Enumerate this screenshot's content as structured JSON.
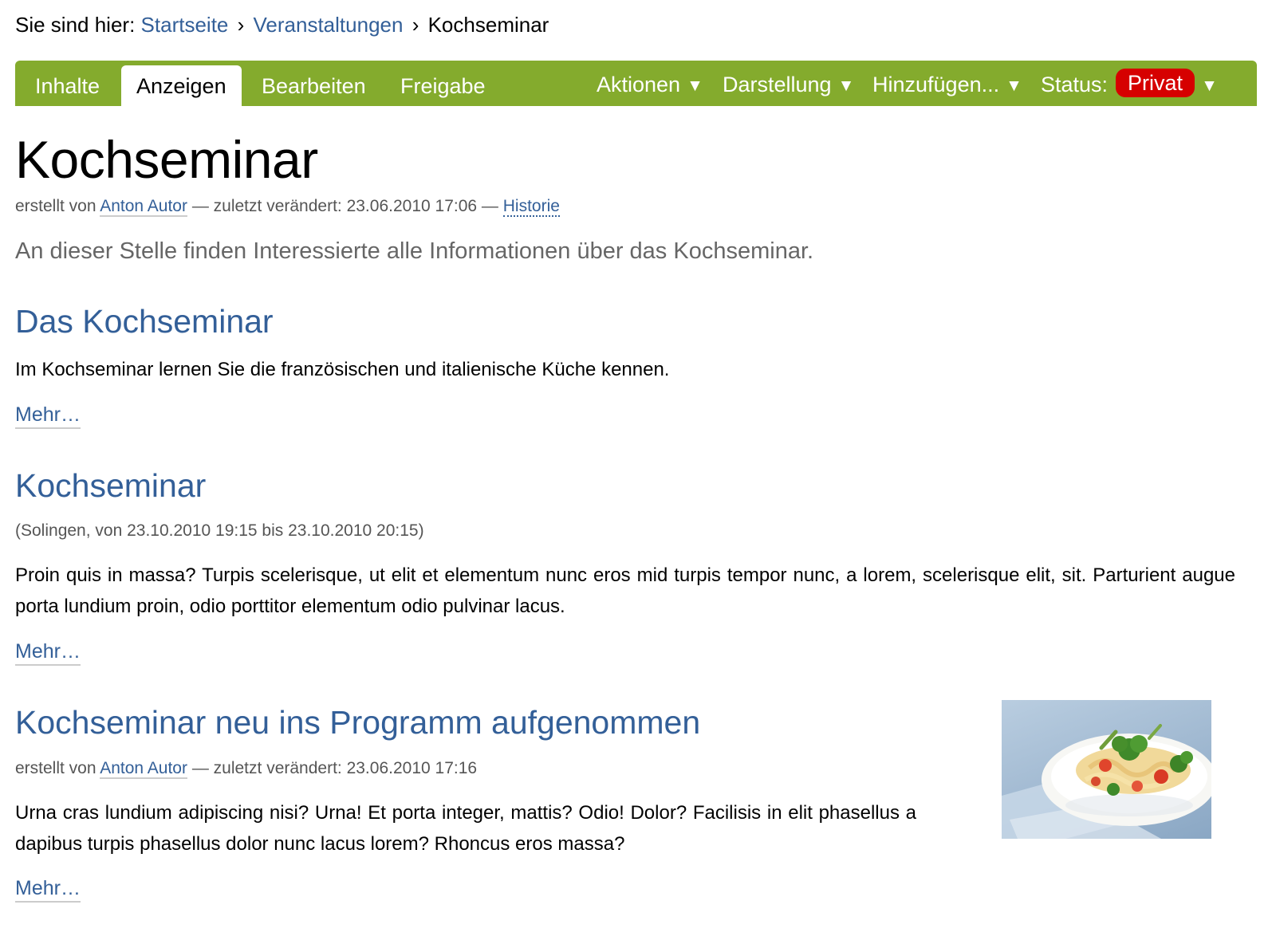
{
  "breadcrumb": {
    "prefix": "Sie sind hier:",
    "items": [
      {
        "label": "Startseite"
      },
      {
        "label": "Veranstaltungen"
      },
      {
        "label": "Kochseminar"
      }
    ],
    "separator": "›"
  },
  "toolbar": {
    "tabs": [
      {
        "label": "Inhalte",
        "active": false
      },
      {
        "label": "Anzeigen",
        "active": true
      },
      {
        "label": "Bearbeiten",
        "active": false
      },
      {
        "label": "Freigabe",
        "active": false
      }
    ],
    "menus": [
      {
        "label": "Aktionen"
      },
      {
        "label": "Darstellung"
      },
      {
        "label": "Hinzufügen..."
      }
    ],
    "status_label": "Status:",
    "status_value": "Privat",
    "arrow": "▼",
    "colors": {
      "bar": "#84ab2d",
      "status": "#d60000"
    }
  },
  "page": {
    "title": "Kochseminar",
    "byline": {
      "created_by": "erstellt von",
      "author": "Anton Autor",
      "modified_label": "— zuletzt verändert: 23.06.2010 17:06 —",
      "history": "Historie"
    },
    "lead": "An dieser Stelle finden Interessierte alle Informationen über das Kochseminar."
  },
  "items": [
    {
      "title": "Das Kochseminar",
      "description": "Im Kochseminar lernen Sie die französischen und italienische Küche kennen.",
      "more": "Mehr…"
    },
    {
      "title": "Kochseminar",
      "meta": "(Solingen, von 23.10.2010 19:15 bis 23.10.2010 20:15)",
      "description": "Proin quis in massa? Turpis scelerisque, ut elit et elementum nunc eros mid turpis tempor nunc, a lorem, scelerisque elit, sit. Parturient augue porta lundium proin, odio porttitor elementum odio pulvinar lacus.",
      "more": "Mehr…"
    },
    {
      "title": "Kochseminar neu ins Programm aufgenommen",
      "byline": {
        "created_by": "erstellt von",
        "author": "Anton Autor",
        "modified_label": "— zuletzt verändert: 23.06.2010 17:16"
      },
      "description": "Urna cras lundium adipiscing nisi? Urna! Et porta integer, mattis? Odio! Dolor? Facilisis in elit phasellus a dapibus turpis phasellus dolor nunc lacus lorem? Rhoncus eros massa?",
      "more": "Mehr…",
      "image": "pasta-dish-photo"
    }
  ],
  "colors": {
    "link": "#335f98",
    "meta": "#555555",
    "lead": "#666666"
  }
}
